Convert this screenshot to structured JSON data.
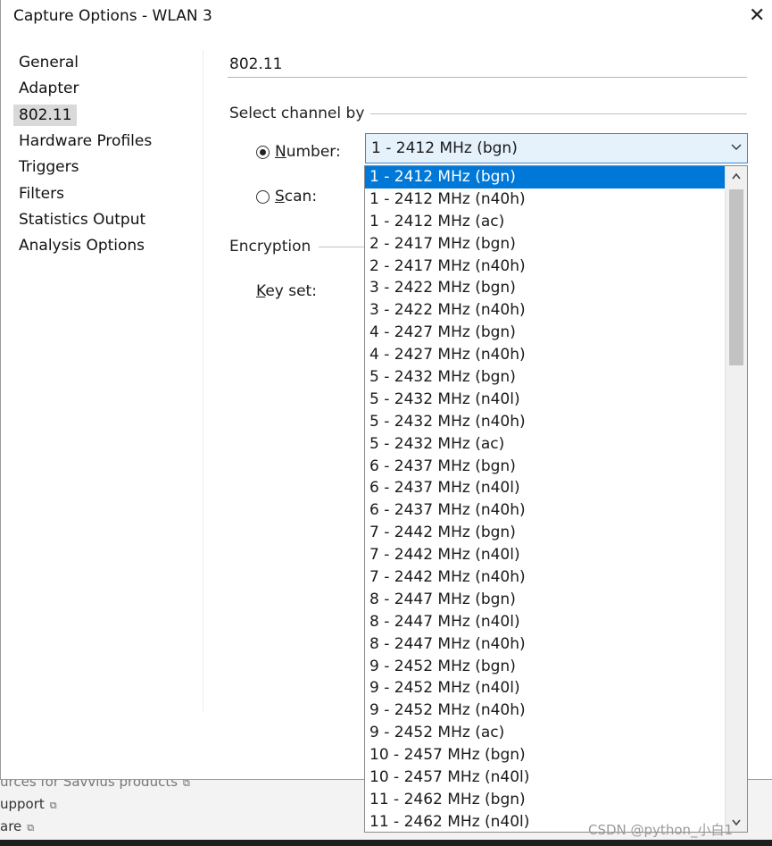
{
  "window": {
    "title": "Capture Options - WLAN 3",
    "close_glyph": "✕"
  },
  "nav": [
    {
      "label": "General",
      "active": false
    },
    {
      "label": "Adapter",
      "active": false
    },
    {
      "label": "802.11",
      "active": true
    },
    {
      "label": "Hardware Profiles",
      "active": false
    },
    {
      "label": "Triggers",
      "active": false
    },
    {
      "label": "Filters",
      "active": false
    },
    {
      "label": "Statistics Output",
      "active": false
    },
    {
      "label": "Analysis Options",
      "active": false
    }
  ],
  "section": {
    "title": "802.11"
  },
  "channel": {
    "group_label": "Select channel by",
    "number": {
      "mnemonic": "N",
      "rest": "umber:",
      "selected": true
    },
    "scan": {
      "mnemonic": "S",
      "rest": "can:",
      "selected": false
    },
    "select_value": "1 - 2412 MHz (bgn)",
    "options": [
      "1 - 2412 MHz (bgn)",
      "1 - 2412 MHz (n40h)",
      "1 - 2412 MHz (ac)",
      "2 - 2417 MHz (bgn)",
      "2 - 2417 MHz (n40h)",
      "3 - 2422 MHz (bgn)",
      "3 - 2422 MHz (n40h)",
      "4 - 2427 MHz (bgn)",
      "4 - 2427 MHz (n40h)",
      "5 - 2432 MHz (bgn)",
      "5 - 2432 MHz (n40l)",
      "5 - 2432 MHz (n40h)",
      "5 - 2432 MHz (ac)",
      "6 - 2437 MHz (bgn)",
      "6 - 2437 MHz (n40l)",
      "6 - 2437 MHz (n40h)",
      "7 - 2442 MHz (bgn)",
      "7 - 2442 MHz (n40l)",
      "7 - 2442 MHz (n40h)",
      "8 - 2447 MHz (bgn)",
      "8 - 2447 MHz (n40l)",
      "8 - 2447 MHz (n40h)",
      "9 - 2452 MHz (bgn)",
      "9 - 2452 MHz (n40l)",
      "9 - 2452 MHz (n40h)",
      "9 - 2452 MHz (ac)",
      "10 - 2457 MHz (bgn)",
      "10 - 2457 MHz (n40l)",
      "11 - 2462 MHz (bgn)",
      "11 - 2462 MHz (n40l)"
    ],
    "selected_index": 0
  },
  "encryption": {
    "group_label": "Encryption",
    "key_set": {
      "mnemonic": "K",
      "rest": "ey set:"
    }
  },
  "background": {
    "lines": [
      "urces for Savvius products",
      "upport",
      "are"
    ]
  },
  "watermark": "CSDN @python_小白1",
  "icons": {
    "close": "close-icon",
    "radio": "radio-icon",
    "dropdown": "chevron-down-icon",
    "scroll_up": "scroll-up-icon",
    "scroll_down": "scroll-down-icon",
    "external": "external-link-icon"
  },
  "colors": {
    "selection": "#0078d7",
    "select_border": "#3a88d8",
    "select_bg": "#e5f1fb"
  }
}
